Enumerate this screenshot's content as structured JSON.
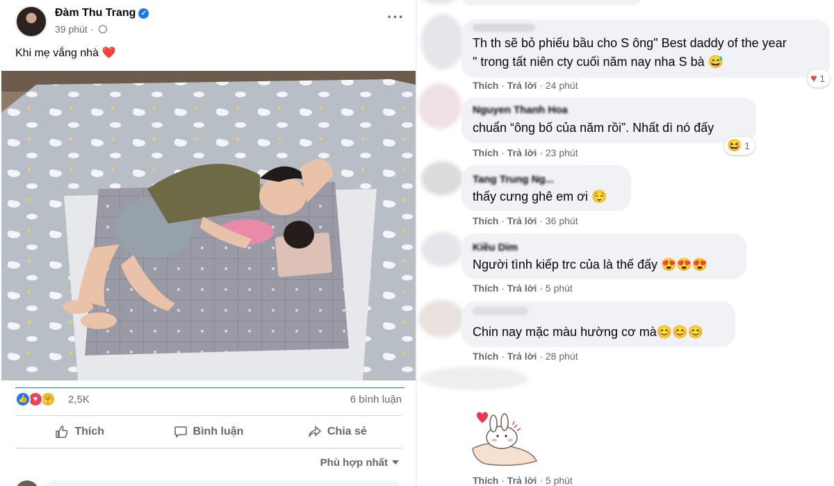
{
  "post": {
    "author": "Đàm Thu Trang",
    "time": "39 phút",
    "caption": "Khi mẹ vắng nhà",
    "reaction_count": "2,5K",
    "comment_count": "6 bình luận",
    "actions": {
      "like": "Thích",
      "comment": "Bình luận",
      "share": "Chia sẻ"
    },
    "sort_label": "Phù hợp nhất",
    "icons": [
      "verified-icon",
      "globe-icon",
      "more-icon",
      "heart-icon",
      "like-reaction-icon",
      "love-reaction-icon",
      "care-reaction-icon",
      "thumb-up-icon",
      "comment-icon",
      "share-icon",
      "caret-down-icon"
    ]
  },
  "comments": [
    {
      "name": "",
      "text_line1": "Th th sẽ bỏ phiếu bầu cho S ông\" Best daddy of the year",
      "text_line2": "\" trong tất niên cty cuối năm nay nha S bà 😅",
      "like": "Thích",
      "reply": "Trả lời",
      "time": "24 phút",
      "reaction_count": "1",
      "reaction": "heart"
    },
    {
      "name": "Nguyen Thanh Hoa",
      "text": "chuẩn “ông bố của năm rồi”. Nhất dì nó đấy",
      "like": "Thích",
      "reply": "Trả lời",
      "time": "23 phút",
      "reaction_count": "1",
      "reaction": "haha"
    },
    {
      "name": "Tang Trung Ng...",
      "text": "thấy cưng ghê em ơi 😌",
      "like": "Thích",
      "reply": "Trả lời",
      "time": "36 phút"
    },
    {
      "name": "Kiều Dim",
      "text": "Người tình kiếp trc của là thế đấy 😍😍😍",
      "like": "Thích",
      "reply": "Trả lời",
      "time": "5 phút"
    },
    {
      "name": "",
      "text": "Chin nay mặc màu hường cơ mà😊😊😊",
      "like": "Thích",
      "reply": "Trả lời",
      "time": "28 phút"
    },
    {
      "name": "",
      "sticker": "bunny-heart-sticker",
      "like": "Thích",
      "reply": "Trả lời",
      "time": "5 phút"
    }
  ],
  "colors": {
    "accent": "#1877f2",
    "secondary_text": "#65676b",
    "bubble": "#f0f2f5",
    "love": "#e41e3f"
  }
}
